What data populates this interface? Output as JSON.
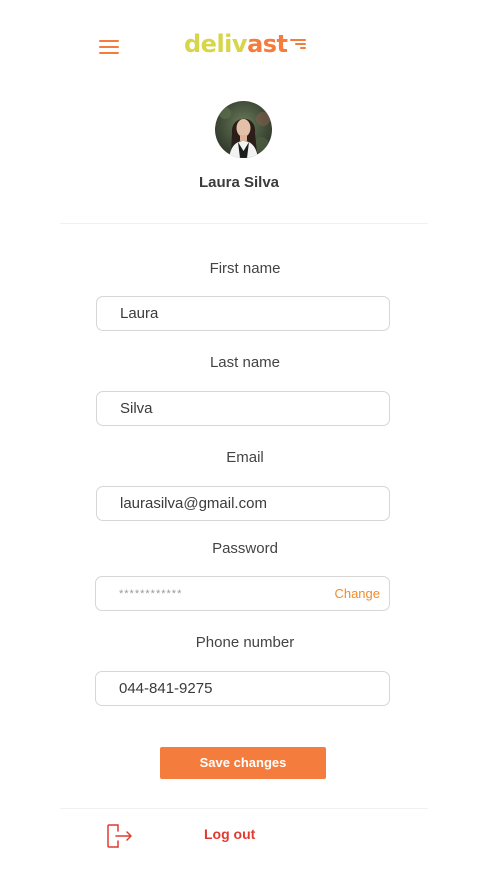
{
  "header": {
    "menu_icon": "hamburger-menu-icon",
    "logo_part_a": "deliv",
    "logo_part_b": "ast",
    "logo_colors": {
      "primary": "#d7d54a",
      "accent": "#f47c3c"
    }
  },
  "profile": {
    "name": "Laura Silva",
    "avatar_icon": "user-avatar-photo"
  },
  "form": {
    "first_name": {
      "label": "First name",
      "value": "Laura"
    },
    "last_name": {
      "label": "Last name",
      "value": "Silva"
    },
    "email": {
      "label": "Email",
      "value": "laurasilva@gmail.com"
    },
    "password": {
      "label": "Password",
      "masked_value": "************",
      "change_label": "Change"
    },
    "phone": {
      "label": "Phone number",
      "value": "044-841-9275"
    }
  },
  "actions": {
    "save_label": "Save changes",
    "logout_label": "Log out",
    "logout_icon": "logout-icon"
  },
  "colors": {
    "accent": "#f47c3c",
    "logout": "#e23a30",
    "text": "#444444",
    "border": "#d6d6d6"
  }
}
